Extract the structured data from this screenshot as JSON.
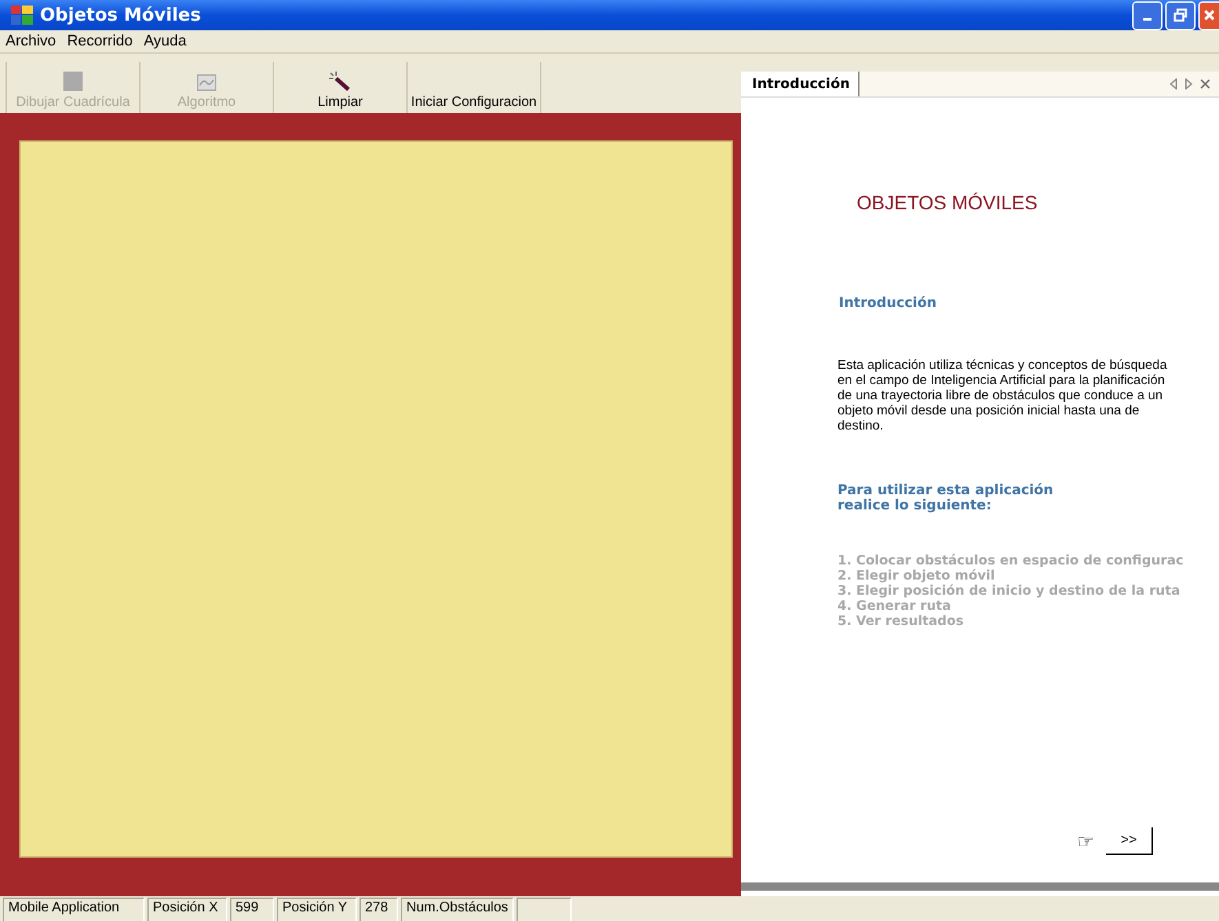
{
  "window": {
    "title": "Objetos Móviles"
  },
  "menu": [
    "Archivo",
    "Recorrido",
    "Ayuda"
  ],
  "toolbar": [
    {
      "label": "Dibujar Cuadrícula",
      "disabled": true
    },
    {
      "label": "Algoritmo",
      "disabled": true
    },
    {
      "label": "Limpiar",
      "disabled": false
    },
    {
      "label": "Iniciar Configuracion",
      "disabled": false
    }
  ],
  "panel": {
    "tabs": [
      {
        "label": "Introducción",
        "selected": true
      }
    ],
    "heading": "OBJETOS MÓVILES",
    "section_title": "Introducción",
    "description": "Esta aplicación utiliza técnicas y conceptos de búsqueda en el campo de Inteligencia Artificial para la planificación de una trayectoria libre de obstáculos que conduce a un objeto móvil desde una posición inicial hasta una de destino.",
    "steps_title": "Para utilizar esta aplicación realice lo siguiente:",
    "steps": [
      "1. Colocar obstáculos en espacio de configurac",
      "2. Elegir objeto móvil",
      "3. Elegir posición de inicio y destino de la ruta",
      "4. Generar ruta",
      "5. Ver resultados"
    ],
    "pointer": "☞",
    "next_button": ">>"
  },
  "status_bar": [
    "Mobile Application",
    "Posición X",
    "599",
    "Posición Y",
    "278",
    "Num.Obstáculos"
  ]
}
